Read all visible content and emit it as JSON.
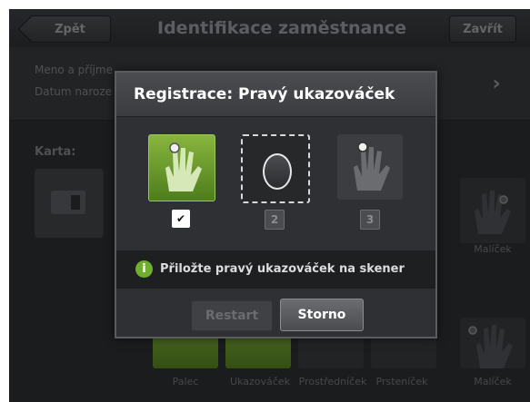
{
  "header": {
    "back_label": "Zpět",
    "title": "Identifikace zaměstnance",
    "close_label": "Zavřít"
  },
  "info": {
    "name_label": "Meno a příjme",
    "dob_label": "Datum naroze",
    "next_arrow": "›"
  },
  "card": {
    "label": "Karta:"
  },
  "fingers": {
    "top_label": "Malíček",
    "bottom_labels": [
      "Palec",
      "Ukazováček",
      "Prostředníček",
      "Prsteníček",
      "Malíček"
    ]
  },
  "modal": {
    "title": "Registrace: Pravý ukazováček",
    "steps": [
      {
        "badge": "✔",
        "state": "done",
        "icon": "hand-icon"
      },
      {
        "badge": "2",
        "state": "active",
        "icon": "fingerprint-oval-icon"
      },
      {
        "badge": "3",
        "state": "pending",
        "icon": "hand-icon"
      }
    ],
    "message": "Přiložte pravý ukazováček na skener",
    "restart_label": "Restart",
    "cancel_label": "Storno"
  },
  "colors": {
    "accent_green": "#6fae2e",
    "background": "#2a2c2f"
  }
}
